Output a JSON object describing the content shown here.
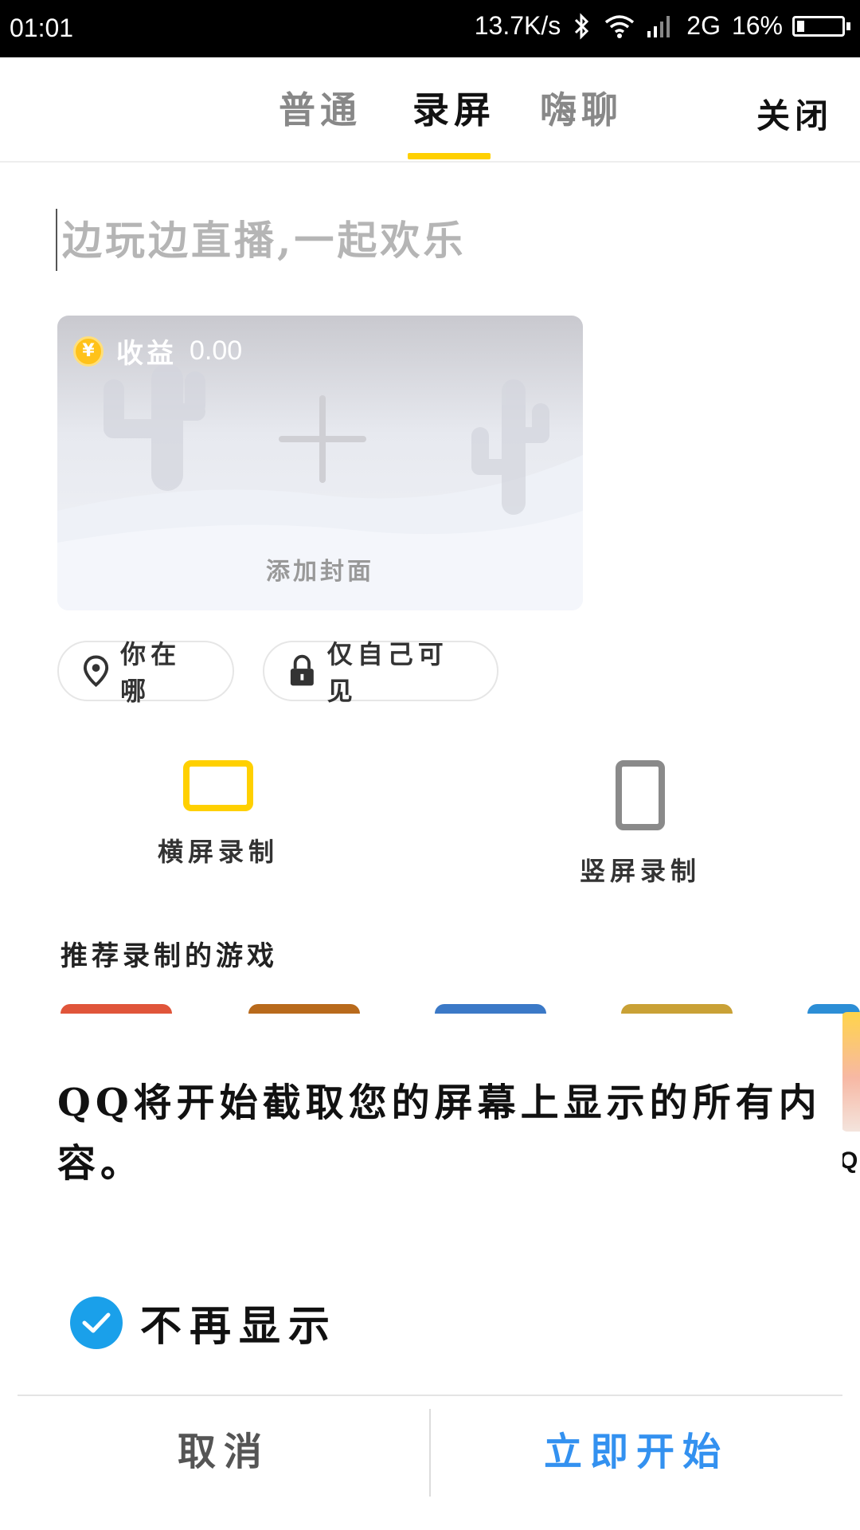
{
  "status_bar": {
    "time": "01:01",
    "speed": "13.7K/s",
    "network": "2G",
    "battery": "16%",
    "battery_level": 0.16
  },
  "tabs": [
    {
      "label": "普通",
      "active": false
    },
    {
      "label": "录屏",
      "active": true
    },
    {
      "label": "嗨聊",
      "active": false
    }
  ],
  "close_label": "关闭",
  "title_input": {
    "placeholder": "边玩边直播,一起欢乐",
    "value": ""
  },
  "cover": {
    "earnings_label": "收益",
    "earnings_value": "0.00",
    "coin_symbol": "¥",
    "add_cover_label": "添加封面"
  },
  "location_label": "你在哪",
  "privacy_label": "仅自己可见",
  "orientation": {
    "landscape_label": "横屏录制",
    "portrait_label": "竖屏录制",
    "selected": "landscape"
  },
  "games_title": "推荐录制的游戏",
  "dialog": {
    "message": "QQ将开始截取您的屏幕上显示的所有内容。",
    "checkbox_label": "不再显示",
    "checkbox_checked": true,
    "cancel_label": "取消",
    "start_label": "立即开始",
    "peek_text": "Q"
  },
  "colors": {
    "accent_yellow": "#ffd000",
    "check_blue": "#1aa0ea",
    "start_blue": "#3391f0"
  }
}
